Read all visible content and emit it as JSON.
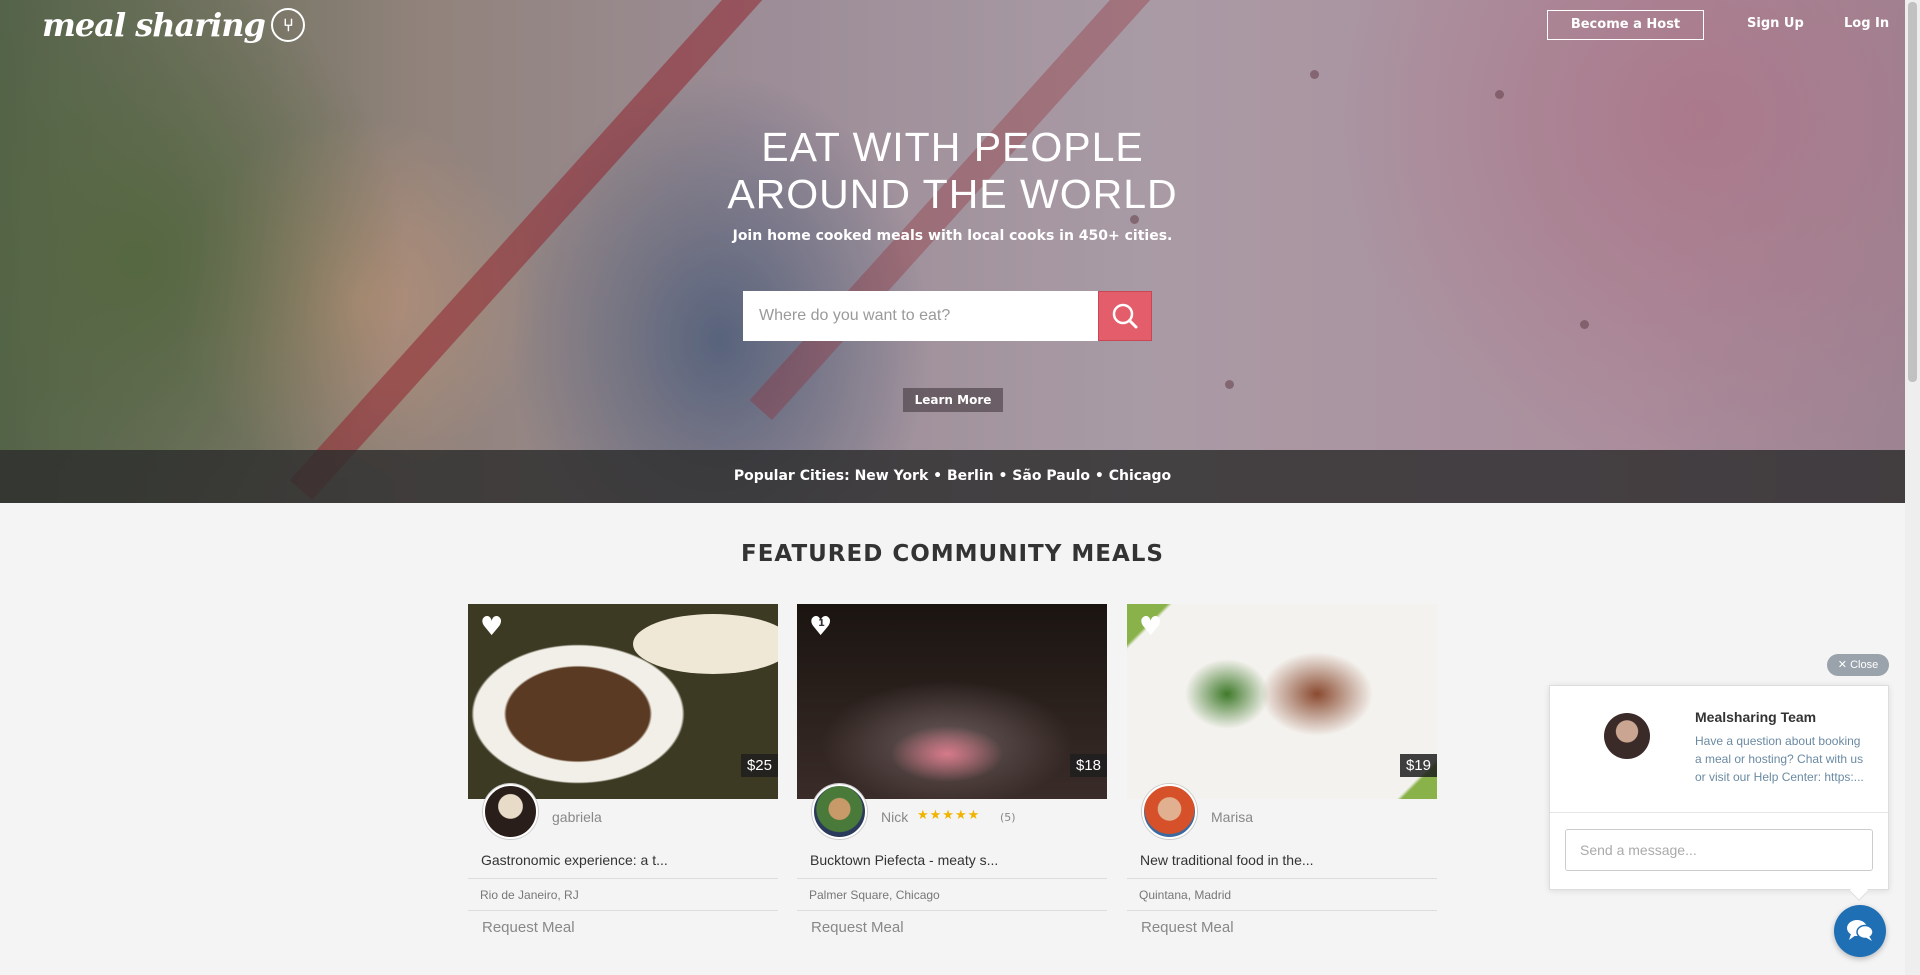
{
  "nav": {
    "logo": "meal sharing",
    "become_host": "Become a Host",
    "sign_up": "Sign Up",
    "log_in": "Log In"
  },
  "hero": {
    "headline_line1": "EAT WITH PEOPLE",
    "headline_line2": "AROUND THE WORLD",
    "subline": "Join home cooked meals with local cooks in 450+ cities.",
    "search_placeholder": "Where do you want to eat?",
    "learn_more": "Learn More",
    "popular_cities": "Popular Cities: New York • Berlin • São Paulo • Chicago"
  },
  "featured": {
    "title": "FEATURED COMMUNITY MEALS",
    "cards": [
      {
        "price": "$25",
        "host": "gabriela",
        "title": "Gastronomic experience: a t...",
        "location": "Rio de Janeiro, RJ",
        "request": "Request Meal",
        "rating": 0,
        "reviews": "",
        "likes": ""
      },
      {
        "price": "$18",
        "host": "Nick",
        "title": "Bucktown Piefecta - meaty s...",
        "location": "Palmer Square, Chicago",
        "request": "Request Meal",
        "rating": 5,
        "reviews": "(5)",
        "likes": "1"
      },
      {
        "price": "$19",
        "host": "Marisa",
        "title": "New traditional food in the...",
        "location": "Quintana, Madrid",
        "request": "Request Meal",
        "rating": 0,
        "reviews": "",
        "likes": ""
      }
    ]
  },
  "chat": {
    "close": "✕ Close",
    "team_name": "Mealsharing Team",
    "message": "Have a question about booking a meal or hosting? Chat with us or visit our Help Center: https:...",
    "input_placeholder": "Send a message..."
  },
  "colors": {
    "accent": "#e35d6a",
    "chat_blue": "#1f6fb5"
  }
}
